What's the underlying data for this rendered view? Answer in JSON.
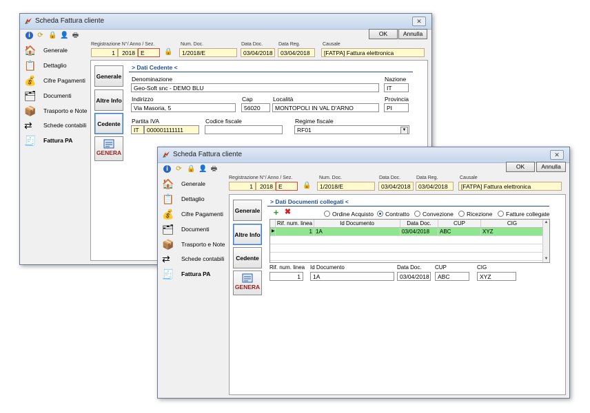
{
  "colors": {
    "accent": "#1f4f99",
    "selected_row": "#8fe68f",
    "field_yellow": "#fffbcf",
    "genera_red": "#9b1c1c"
  },
  "window_back": {
    "title": "Scheda Fattura cliente",
    "close_label": "✕",
    "ok_label": "OK",
    "cancel_label": "Annulla",
    "toolbar_icons": [
      "info-icon",
      "refresh-icon",
      "lock-icon",
      "user-icon",
      "printer-icon"
    ],
    "nav": [
      {
        "label": "Generale",
        "icon": "house-icon"
      },
      {
        "label": "Dettaglio",
        "icon": "detail-icon"
      },
      {
        "label": "Cifre Pagamenti",
        "icon": "coins-icon"
      },
      {
        "label": "Documenti",
        "icon": "documents-icon"
      },
      {
        "label": "Trasporto e Note",
        "icon": "truck-icon"
      },
      {
        "label": "Schede contabili",
        "icon": "accounting-icon"
      },
      {
        "label": "Fattura PA",
        "icon": "invoice-pa-icon"
      }
    ],
    "header": {
      "reg_label": "Registrazione N°/ Anno / Sez.",
      "reg_number": "1",
      "reg_year": "2018",
      "reg_section": "E",
      "num_doc_label": "Num. Doc.",
      "num_doc": "1/2018/E",
      "data_doc_label": "Data Doc.",
      "data_doc": "03/04/2018",
      "data_reg_label": "Data Reg.",
      "data_reg": "03/04/2018",
      "causale_label": "Causale",
      "causale": "[FATPA] Fattura elettronica"
    },
    "side_buttons": [
      "Generale",
      "Altre Info",
      "Cedente"
    ],
    "genera_label": "GENERA",
    "section_title": "> Dati Cedente <",
    "fields": {
      "denominazione_label": "Denominazione",
      "denominazione": "Geo-Soft snc - DEMO BLU",
      "nazione_label": "Nazione",
      "nazione": "IT",
      "indirizzo_label": "Indirizzo",
      "indirizzo": "Via Masoria, 5",
      "cap_label": "Cap",
      "cap": "56020",
      "localita_label": "Località",
      "localita": "MONTOPOLI IN VAL D'ARNO",
      "provincia_label": "Provincia",
      "provincia": "PI",
      "partita_iva_label": "Partita IVA",
      "partita_iva_country": "IT",
      "partita_iva": "000001111111",
      "codice_fiscale_label": "Codice fiscale",
      "codice_fiscale": "",
      "regime_fiscale_label": "Regime fiscale",
      "regime_fiscale": "RF01"
    }
  },
  "window_front": {
    "title": "Scheda Fattura cliente",
    "close_label": "✕",
    "ok_label": "OK",
    "cancel_label": "Annulla",
    "nav": [
      {
        "label": "Generale",
        "icon": "house-icon"
      },
      {
        "label": "Dettaglio",
        "icon": "detail-icon"
      },
      {
        "label": "Cifre Pagamenti",
        "icon": "coins-icon"
      },
      {
        "label": "Documenti",
        "icon": "documents-icon"
      },
      {
        "label": "Trasporto e Note",
        "icon": "truck-icon"
      },
      {
        "label": "Schede contabili",
        "icon": "accounting-icon"
      },
      {
        "label": "Fattura PA",
        "icon": "invoice-pa-icon"
      }
    ],
    "header": {
      "reg_label": "Registrazione N°/ Anno / Sez.",
      "reg_number": "1",
      "reg_year": "2018",
      "reg_section": "E",
      "num_doc_label": "Num. Doc.",
      "num_doc": "1/2018/E",
      "data_doc_label": "Data Doc.",
      "data_doc": "03/04/2018",
      "data_reg_label": "Data Reg.",
      "data_reg": "03/04/2018",
      "causale_label": "Causale",
      "causale": "[FATPA] Fattura elettronica"
    },
    "side_buttons": [
      "Generale",
      "Altre Info",
      "Cedente"
    ],
    "genera_label": "GENERA",
    "section_title": "> Dati Documenti collegati <",
    "radios": [
      {
        "label": "Ordine Acquisto",
        "selected": false
      },
      {
        "label": "Contratto",
        "selected": true
      },
      {
        "label": "Convezione",
        "selected": false
      },
      {
        "label": "Ricezione",
        "selected": false
      },
      {
        "label": "Fatture collegate",
        "selected": false
      }
    ],
    "grid": {
      "columns": [
        "Rif. num. linea",
        "Id Documento",
        "Data Doc.",
        "CUP",
        "CIG"
      ],
      "rows": [
        {
          "rif": "1",
          "id": "1A",
          "data": "03/04/2018",
          "cup": "ABC",
          "cig": "XYZ"
        }
      ]
    },
    "detail": {
      "rif_label": "Rif. num. linea",
      "rif": "1",
      "id_label": "Id Documento",
      "id": "1A",
      "data_label": "Data Doc.",
      "data": "03/04/2018",
      "cup_label": "CUP",
      "cup": "ABC",
      "cig_label": "CIG",
      "cig": "XYZ"
    }
  }
}
